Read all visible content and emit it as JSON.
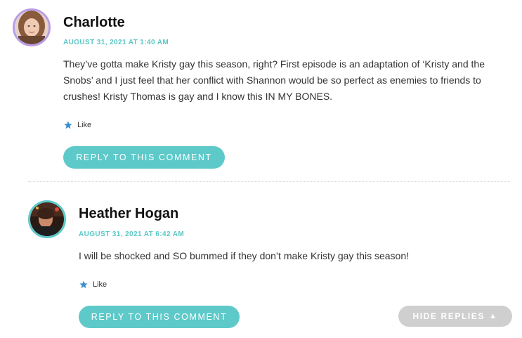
{
  "comments": [
    {
      "author": "Charlotte",
      "date": "AUGUST 31, 2021 AT 1:40 AM",
      "text": "They’ve gotta make Kristy gay this season, right? First episode is an adaptation of ‘Kristy and the Snobs’ and I just feel that her conflict with Shannon would be so perfect as enemies to friends to crushes! Kristy Thomas is gay and I know this IN MY BONES.",
      "like_label": "Like",
      "reply_label": "REPLY TO THIS COMMENT",
      "avatar_ring_color": "#b79ce6"
    },
    {
      "author": "Heather Hogan",
      "date": "AUGUST 31, 2021 AT 6:42 AM",
      "text": "I will be shocked and SO bummed if they don’t make Kristy gay this season!",
      "like_label": "Like",
      "reply_label": "REPLY TO THIS COMMENT",
      "avatar_ring_color": "#5ec9c9"
    }
  ],
  "hide_replies": {
    "label": "HIDE REPLIES",
    "icon": "triangle-up-icon"
  },
  "colors": {
    "accent": "#5ec9c9",
    "date": "#5bc7c7",
    "hide_button": "#cfcfcf",
    "like_star": "#3b8fd0"
  }
}
